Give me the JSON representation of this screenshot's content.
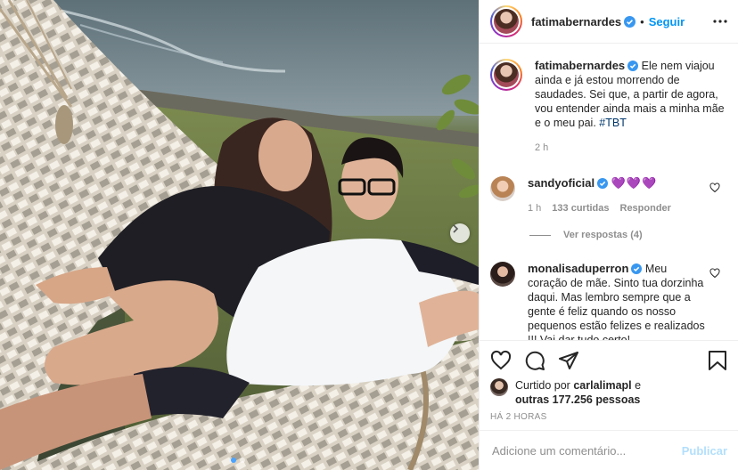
{
  "post": {
    "author": "fatimabernardes",
    "follow_label": "Seguir",
    "bullet": "•",
    "photo": {
      "carousel_dots": 2,
      "active_dot": 0
    }
  },
  "caption": {
    "username": "fatimabernardes",
    "text": "Ele nem viajou ainda e já estou morrendo de saudades. Sei que, a partir de agora, vou entender ainda mais a minha mãe e o meu pai.",
    "hashtag": "#TBT",
    "time": "2 h"
  },
  "comments": [
    {
      "username": "sandyoficial",
      "text": "💜💜💜",
      "time": "1 h",
      "likes": "133 curtidas",
      "reply_label": "Responder",
      "view_replies": "Ver respostas (4)"
    },
    {
      "username": "monalisaduperron",
      "text": "Meu coração de mãe. Sinto tua dorzinha daqui. Mas lembro sempre que a gente é feliz quando os nosso pequenos estão felizes e realizados !!! Vai dar tudo certo!"
    }
  ],
  "likes": {
    "prefix": "Curtido por",
    "user": "carlalimapl",
    "conjunction": "e",
    "others": "outras 177.256 pessoas"
  },
  "timestamp": "HÁ 2 HORAS",
  "add_comment": {
    "placeholder": "Adicione um comentário...",
    "publish_label": "Publicar"
  },
  "colors": {
    "link": "#0095f6",
    "verified": "#3897f0",
    "muted": "#8e8e8e",
    "text": "#262626",
    "publish_disabled": "#b2dffc"
  },
  "icons": [
    "verified-icon",
    "more-options-icon",
    "heart-icon",
    "comment-icon",
    "share-icon",
    "save-icon",
    "chevron-right-icon"
  ]
}
